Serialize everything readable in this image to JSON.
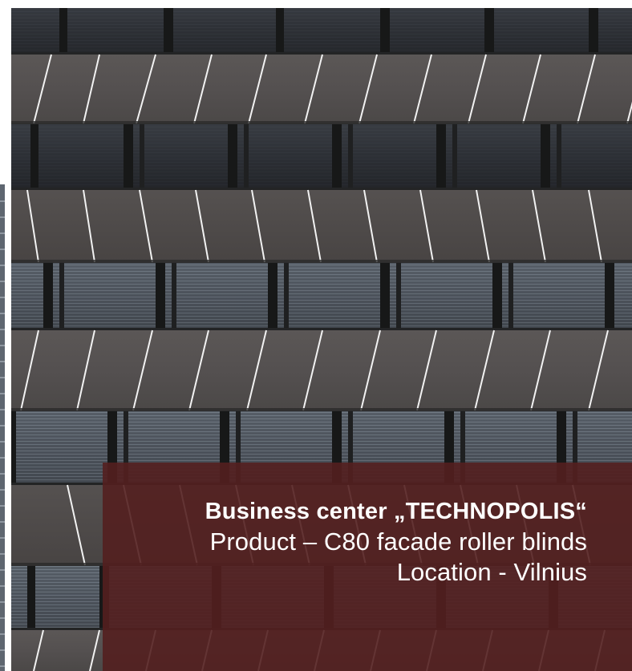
{
  "photo": {
    "subject": "building-facade-photo",
    "facade_color": "#5b5756",
    "window_color": "#2c2d31",
    "frame_color": "#171818",
    "seam_color": "#f2f2f2"
  },
  "caption": {
    "title": "Business center  „TECHNOPOLIS“",
    "product": "Product – C80 facade roller blinds",
    "location": "Location - Vilnius",
    "panel_color": "#531f1f",
    "text_color": "#ffffff"
  }
}
